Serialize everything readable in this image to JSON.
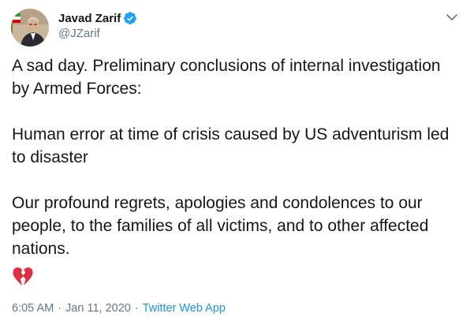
{
  "author": {
    "display_name": "Javad Zarif",
    "handle": "@JZarif",
    "verified": true,
    "verified_color": "#1da1f2"
  },
  "tweet": {
    "paragraphs": [
      "A sad day. Preliminary conclusions of internal investigation by Armed Forces:",
      "Human error at time of crisis caused by US adventurism led to disaster",
      "Our profound regrets, apologies and condolences to our people, to the families of all victims, and to other affected nations."
    ],
    "emoji": "broken-heart-icon"
  },
  "meta": {
    "time": "6:05 AM",
    "separator": "·",
    "date": "Jan 11, 2020",
    "source": "Twitter Web App"
  },
  "colors": {
    "text": "#14171a",
    "secondary": "#657786",
    "link": "#1b95e0",
    "heart": "#e0245e"
  }
}
